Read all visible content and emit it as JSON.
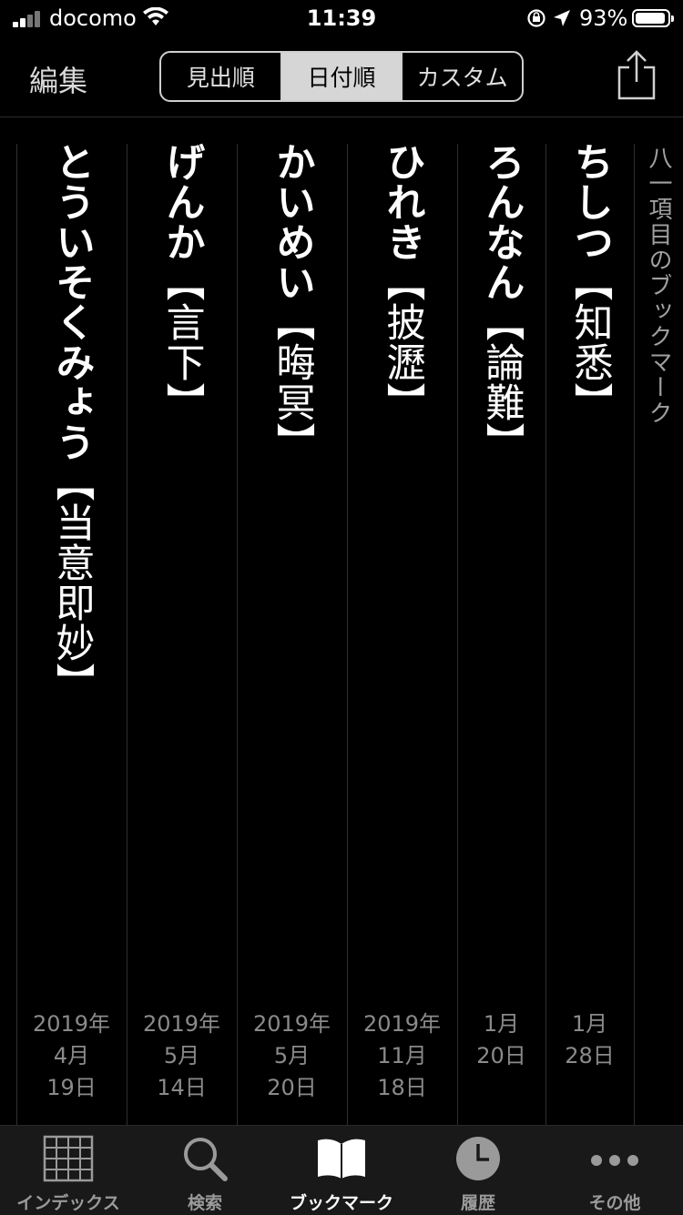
{
  "status": {
    "carrier": "docomo",
    "time": "11:39",
    "battery": "93%",
    "battery_level": 0.93
  },
  "nav": {
    "edit": "編集",
    "segments": [
      {
        "label": "見出順",
        "active": false
      },
      {
        "label": "日付順",
        "active": true
      },
      {
        "label": "カスタム",
        "active": false
      }
    ]
  },
  "bookmarks": {
    "title": "八一項目のブックマーク",
    "items": [
      {
        "kana": "とういそくみょう",
        "kanji": "【当意即妙】",
        "date": [
          "2019年",
          "4月",
          "19日"
        ]
      },
      {
        "kana": "げんか",
        "kanji": "【言下】",
        "date": [
          "2019年",
          "5月",
          "14日"
        ]
      },
      {
        "kana": "かいめい",
        "kanji": "【晦冥】",
        "date": [
          "2019年",
          "5月",
          "20日"
        ]
      },
      {
        "kana": "ひれき",
        "kanji": "【披瀝】",
        "date": [
          "2019年",
          "11月",
          "18日"
        ]
      },
      {
        "kana": "ろんなん",
        "kanji": "【論難】",
        "date": [
          "",
          "1月",
          "20日"
        ]
      },
      {
        "kana": "ちしつ",
        "kanji": "【知悉】",
        "date": [
          "",
          "1月",
          "28日"
        ]
      }
    ]
  },
  "tabs": [
    {
      "label": "インデックス",
      "icon": "grid-icon",
      "active": false
    },
    {
      "label": "検索",
      "icon": "search-icon",
      "active": false
    },
    {
      "label": "ブックマーク",
      "icon": "book-icon",
      "active": true
    },
    {
      "label": "履歴",
      "icon": "clock-icon",
      "active": false
    },
    {
      "label": "その他",
      "icon": "more-icon",
      "active": false
    }
  ]
}
